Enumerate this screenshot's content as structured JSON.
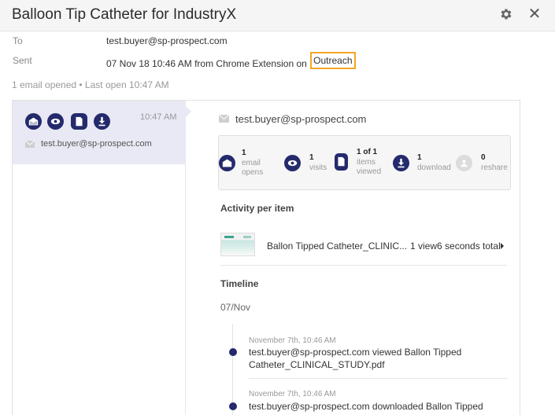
{
  "window": {
    "title": "Balloon Tip Catheter for IndustryX"
  },
  "meta": {
    "to_label": "To",
    "to_value": "test.buyer@sp-prospect.com",
    "sent_label": "Sent",
    "sent_value": "07 Nov 18 10:46 AM from Chrome Extension on",
    "sent_source": "Outreach",
    "summary": "1 email opened • Last open 10:47 AM"
  },
  "thread": {
    "icons": [
      "envelope-open-icon",
      "eye-icon",
      "document-icon",
      "download-icon"
    ],
    "time": "10:47 AM",
    "email": "test.buyer@sp-prospect.com"
  },
  "detail": {
    "email": "test.buyer@sp-prospect.com",
    "stats": [
      {
        "icon": "envelope-open-icon",
        "number": "1",
        "label": "email opens"
      },
      {
        "icon": "eye-icon",
        "number": "1",
        "label": "visits"
      },
      {
        "icon": "document-icon",
        "number": "1 of 1",
        "label": "items viewed"
      },
      {
        "icon": "download-icon",
        "number": "1",
        "label": "download"
      },
      {
        "icon": "reshare-icon",
        "number": "0",
        "label": "reshare"
      }
    ],
    "activity_title": "Activity per item",
    "item": {
      "name": "Ballon Tipped Catheter_CLINIC...",
      "stats": "1 view6 seconds total"
    },
    "timeline_title": "Timeline",
    "timeline_date": "07/Nov",
    "events": [
      {
        "time": "November 7th, 10:46 AM",
        "text": "test.buyer@sp-prospect.com viewed Ballon Tipped Catheter_CLINICAL_STUDY.pdf"
      },
      {
        "time": "November 7th, 10:46 AM",
        "text": "test.buyer@sp-prospect.com downloaded Ballon Tipped Catheter_CLINICAL_STUDY.pdf"
      }
    ]
  },
  "colors": {
    "accent": "#242a6b",
    "highlight": "#f5a623",
    "selected": "#e8e9f4"
  }
}
